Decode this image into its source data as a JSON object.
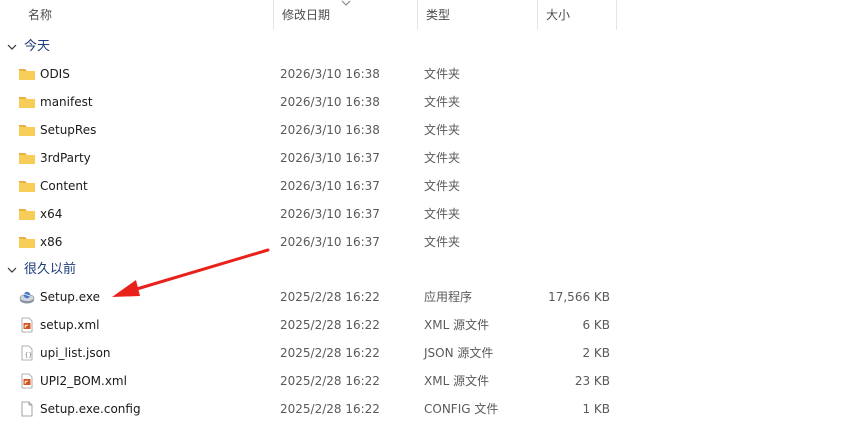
{
  "columns": {
    "name": "名称",
    "date": "修改日期",
    "type": "类型",
    "size": "大小"
  },
  "groups": [
    {
      "title": "今天",
      "items": [
        {
          "name": "ODIS",
          "date": "2026/3/10 16:38",
          "type": "文件夹",
          "size": "",
          "icon": "folder-icon"
        },
        {
          "name": "manifest",
          "date": "2026/3/10 16:38",
          "type": "文件夹",
          "size": "",
          "icon": "folder-icon"
        },
        {
          "name": "SetupRes",
          "date": "2026/3/10 16:38",
          "type": "文件夹",
          "size": "",
          "icon": "folder-icon"
        },
        {
          "name": "3rdParty",
          "date": "2026/3/10 16:37",
          "type": "文件夹",
          "size": "",
          "icon": "folder-icon"
        },
        {
          "name": "Content",
          "date": "2026/3/10 16:37",
          "type": "文件夹",
          "size": "",
          "icon": "folder-icon"
        },
        {
          "name": "x64",
          "date": "2026/3/10 16:37",
          "type": "文件夹",
          "size": "",
          "icon": "folder-icon"
        },
        {
          "name": "x86",
          "date": "2026/3/10 16:37",
          "type": "文件夹",
          "size": "",
          "icon": "folder-icon"
        }
      ]
    },
    {
      "title": "很久以前",
      "items": [
        {
          "name": "Setup.exe",
          "date": "2025/2/28 16:22",
          "type": "应用程序",
          "size": "17,566 KB",
          "icon": "installer-icon"
        },
        {
          "name": "setup.xml",
          "date": "2025/2/28 16:22",
          "type": "XML 源文件",
          "size": "6 KB",
          "icon": "xml-file-icon"
        },
        {
          "name": "upi_list.json",
          "date": "2025/2/28 16:22",
          "type": "JSON 源文件",
          "size": "2 KB",
          "icon": "json-file-icon"
        },
        {
          "name": "UPI2_BOM.xml",
          "date": "2025/2/28 16:22",
          "type": "XML 源文件",
          "size": "23 KB",
          "icon": "xml-file-icon"
        },
        {
          "name": "Setup.exe.config",
          "date": "2025/2/28 16:22",
          "type": "CONFIG 文件",
          "size": "1 KB",
          "icon": "file-icon"
        }
      ]
    }
  ],
  "colors": {
    "folder": "#f3c545",
    "group_title": "#1f3d7a",
    "arrow": "#e8221b"
  }
}
